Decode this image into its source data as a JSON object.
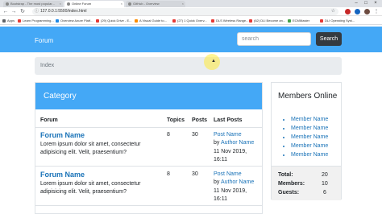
{
  "browser": {
    "tabs": [
      {
        "label": "Bootstrap - The most popular...",
        "active": false
      },
      {
        "label": "Online Forum",
        "active": true
      },
      {
        "label": "GitHub - Overview",
        "active": false
      }
    ],
    "url": "127.0.0.1:5500/index.html",
    "bookmarks": [
      {
        "label": "Apps",
        "color": "#5f6368"
      },
      {
        "label": "Learn Programming...",
        "color": "#e53935"
      },
      {
        "label": "Overview Azure Platf...",
        "color": "#1e88e5"
      },
      {
        "label": "(29) Quick Drive - E...",
        "color": "#e53935"
      },
      {
        "label": "A Visual Guide to...",
        "color": "#fb8c00"
      },
      {
        "label": "(27) 1 Quick Overv...",
        "color": "#e53935"
      },
      {
        "label": "DLS Wireless Range...",
        "color": "#e53935"
      },
      {
        "label": "(62) DLI Become an...",
        "color": "#e53935"
      },
      {
        "label": "ECMMaster",
        "color": "#43a047"
      },
      {
        "label": "DLI Operating Syst...",
        "color": "#e53935"
      }
    ]
  },
  "navbar": {
    "brand": "Forum",
    "search_placeholder": "search",
    "search_button": "Search"
  },
  "breadcrumb": "Index",
  "category": {
    "title": "Category",
    "columns": [
      "Forum",
      "Topics",
      "Posts",
      "Last Posts"
    ],
    "rows": [
      {
        "forum_name": "Forum Name",
        "description": "Lorem ipsum dolor sit amet, consectetur adipisicing elit. Velit, praesentium?",
        "topics": "8",
        "posts": "30",
        "last_post_title": "Post Name",
        "by_prefix": "by",
        "author": "Author Name",
        "date": "11 Nov 2019, 16:11"
      },
      {
        "forum_name": "Forum Name",
        "description": "Lorem ipsum dolor sit amet, consectetur adipisicing elit. Velit, praesentium?",
        "topics": "8",
        "posts": "30",
        "last_post_title": "Post Name",
        "by_prefix": "by",
        "author": "Author Name",
        "date": "11 Nov 2019, 16:11"
      }
    ]
  },
  "members": {
    "title": "Members Online",
    "items": [
      "Member Name",
      "Member Name",
      "Member Name",
      "Member Name",
      "Member Name"
    ],
    "stats": [
      {
        "label": "Total:",
        "value": "20"
      },
      {
        "label": "Members:",
        "value": "10"
      },
      {
        "label": "Guests:",
        "value": "6"
      }
    ]
  },
  "colors": {
    "primary": "#44a8f6",
    "link": "#1a73b8",
    "dark_button": "#343a40",
    "breadcrumb_bg": "#e9ecef"
  }
}
